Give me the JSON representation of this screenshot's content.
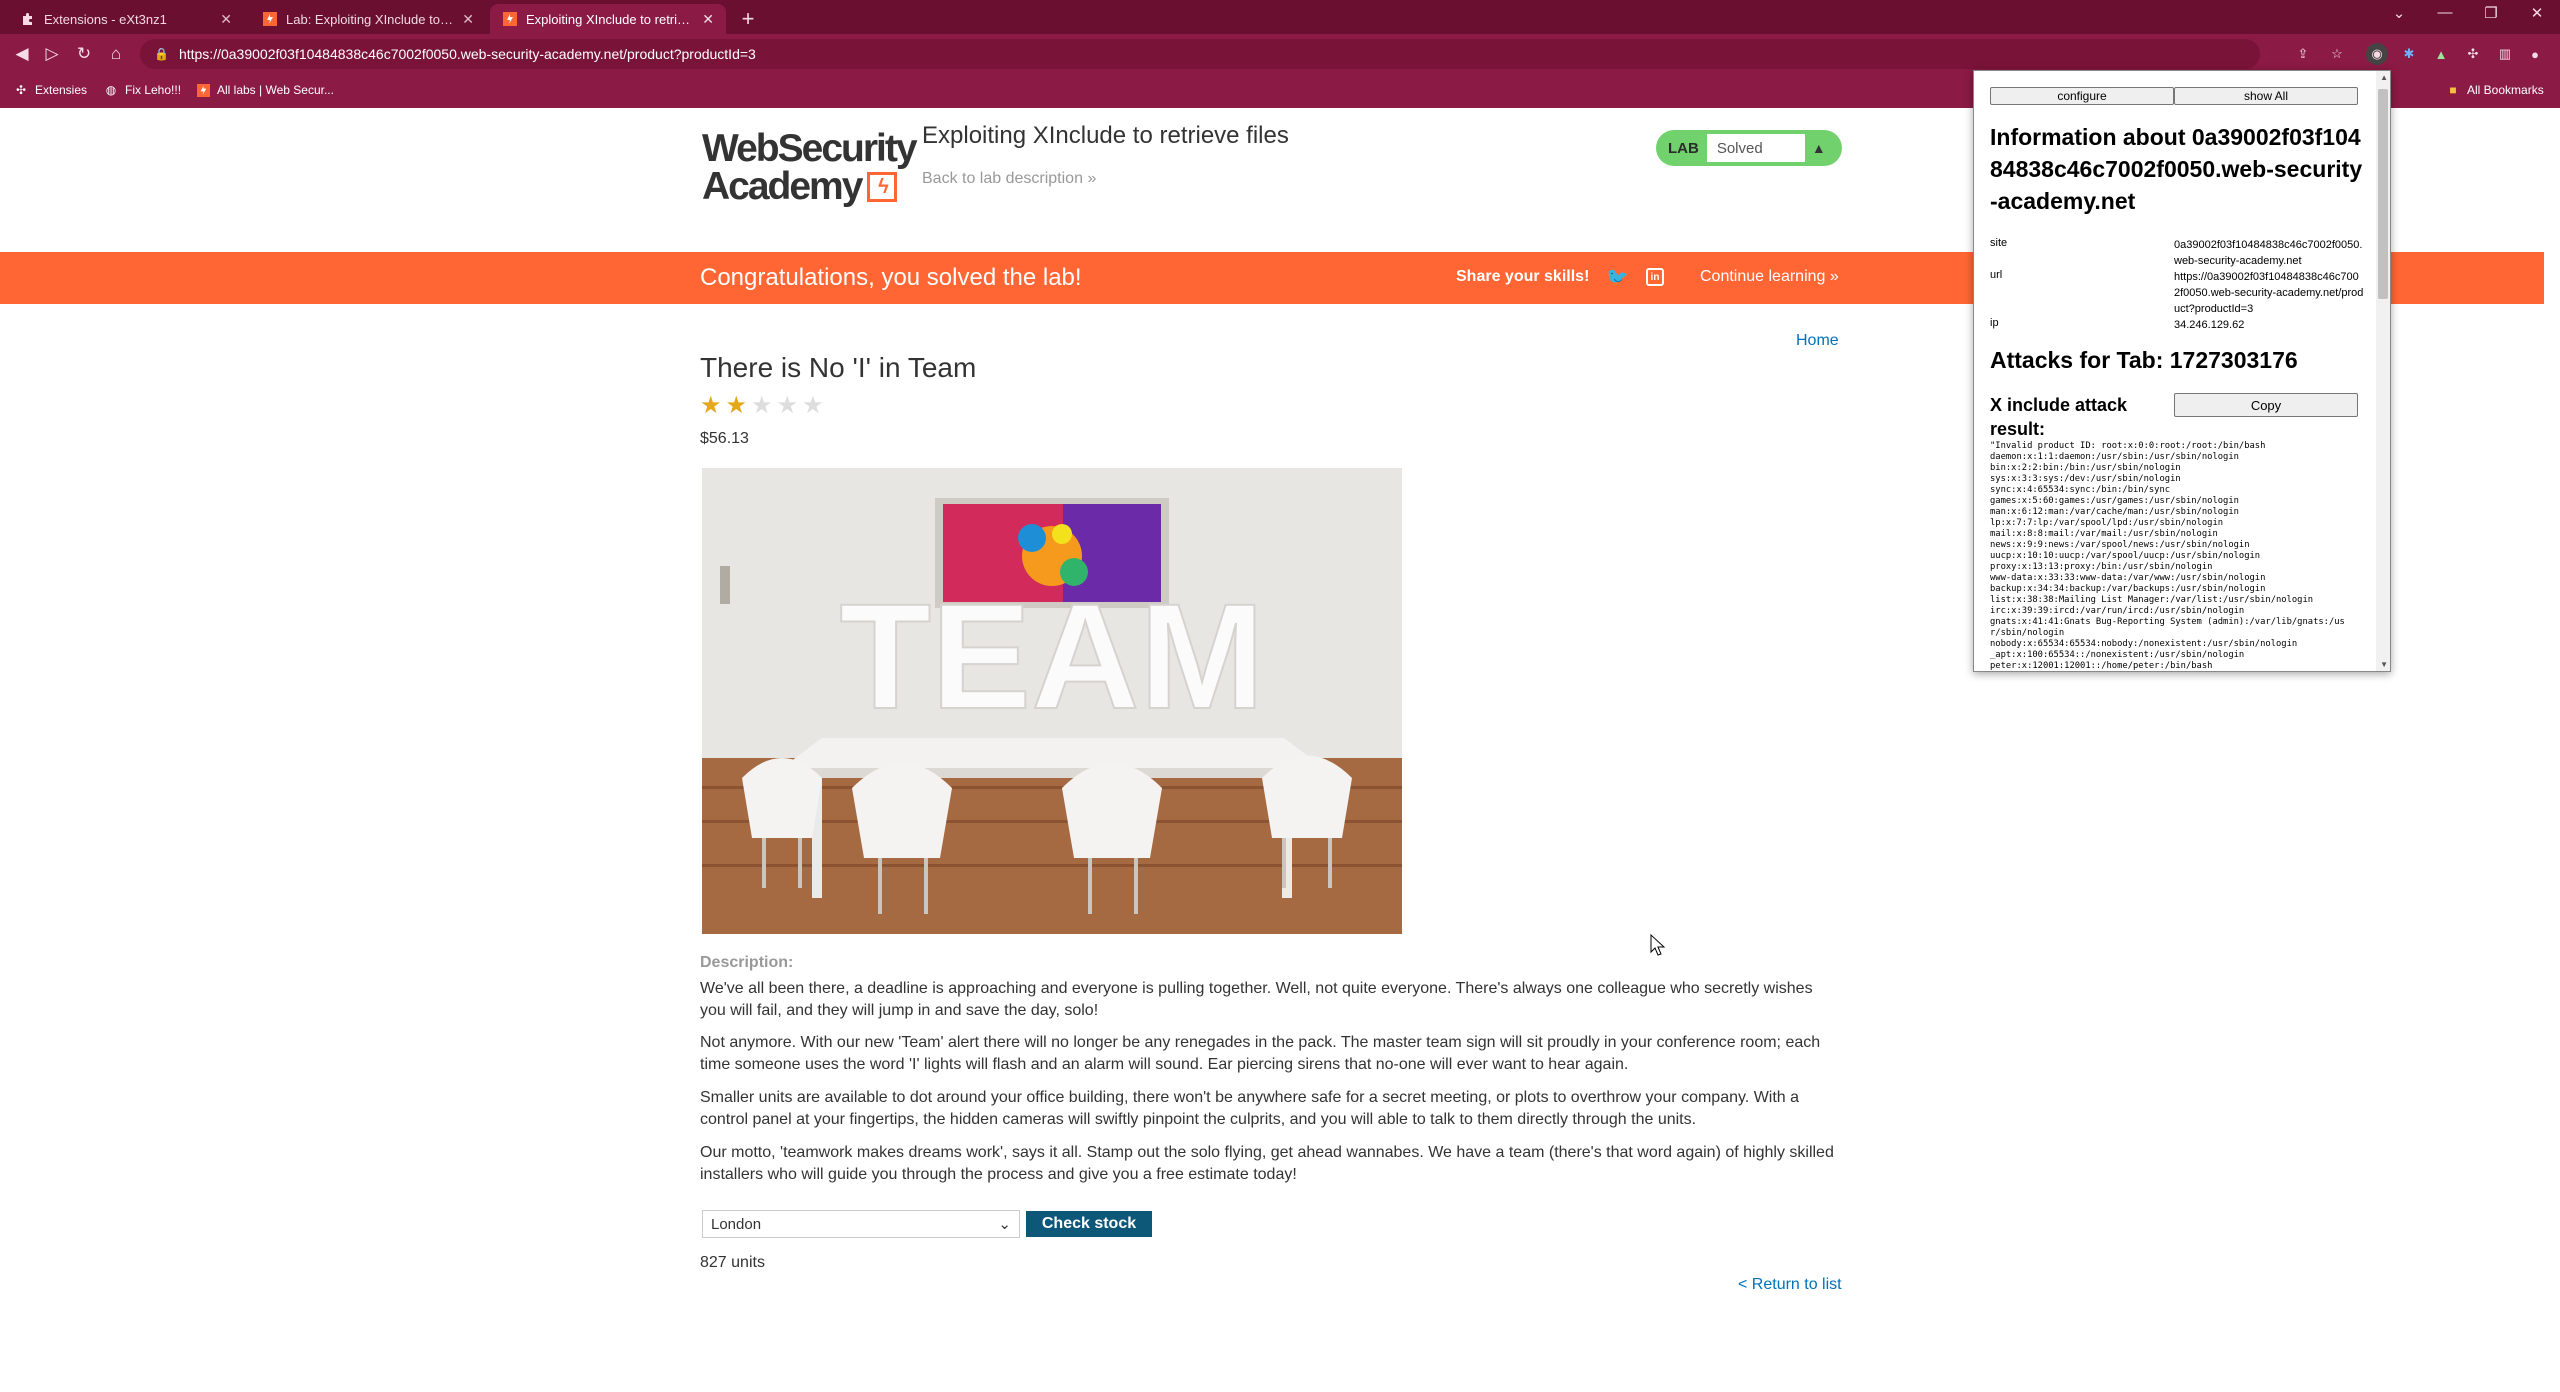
{
  "browser": {
    "tabs": [
      {
        "title": "Extensions - eXt3nz1",
        "active": false
      },
      {
        "title": "Lab: Exploiting XInclude to retri",
        "active": false
      },
      {
        "title": "Exploiting XInclude to retrieve f",
        "active": true
      }
    ],
    "new_tab": "+",
    "url": "https://0a39002f03f10484838c46c7002f0050.web-security-academy.net/product?productId=3",
    "bookmarks": [
      {
        "label": "Extensies",
        "icon": "puzzle-icon"
      },
      {
        "label": "Fix Leho!!!",
        "icon": "globe-icon"
      },
      {
        "label": "All labs | Web Secur...",
        "icon": "portswigger-icon"
      }
    ],
    "all_bookmarks": "All Bookmarks"
  },
  "header": {
    "logo_line1": "WebSecurity",
    "logo_line2": "Academy",
    "lab_title": "Exploiting XInclude to retrieve files",
    "back_link": "Back to lab description",
    "badge_lab": "LAB",
    "badge_status": "Solved"
  },
  "banner": {
    "message": "Congratulations, you solved the lab!",
    "share": "Share your skills!",
    "continue": "Continue learning"
  },
  "nav": {
    "home": "Home"
  },
  "product": {
    "name": "There is No 'I' in Team",
    "rating": 2,
    "rating_max": 5,
    "price": "$56.13",
    "image_text": "TEAM",
    "description_label": "Description:",
    "paragraphs": [
      "We've all been there, a deadline is approaching and everyone is pulling together. Well, not quite everyone. There's always one colleague who secretly wishes you will fail, and they will jump in and save the day, solo!",
      "Not anymore. With our new 'Team' alert there will no longer be any renegades in the pack. The master team sign will sit proudly in your conference room; each time someone uses the word 'I' lights will flash and an alarm will sound. Ear piercing sirens that no-one will ever want to hear again.",
      "Smaller units are available to dot around your office building, there won't be anywhere safe for a secret meeting, or plots to overthrow your company. With a control panel at your fingertips, the hidden cameras will swiftly pinpoint the culprits, and you will able to talk to them directly through the units.",
      "Our motto, 'teamwork makes dreams work', says it all. Stamp out the solo flying, get ahead wannabes. We have a team (there's that word again) of highly skilled installers who will guide you through the process and give you a free estimate today!"
    ],
    "stock_location": "London",
    "check_stock": "Check stock",
    "units": "827 units",
    "return": "< Return to list"
  },
  "popup": {
    "configure": "configure",
    "show_all": "show All",
    "info_title": "Information about 0a39002f03f10484838c46c7002f0050.web-security-academy.net",
    "site_label": "site",
    "site_value": "0a39002f03f10484838c46c7002f0050.web-security-academy.net",
    "url_label": "url",
    "url_value": "https://0a39002f03f10484838c46c7002f0050.web-security-academy.net/product?productId=3",
    "ip_label": "ip",
    "ip_value": "34.246.129.62",
    "attacks_title": "Attacks for Tab: 1727303176",
    "xinclude_title": "X include attack result:",
    "copy": "Copy",
    "result_lines": [
      "\"Invalid product ID: root:x:0:0:root:/root:/bin/bash",
      "daemon:x:1:1:daemon:/usr/sbin:/usr/sbin/nologin",
      "bin:x:2:2:bin:/bin:/usr/sbin/nologin",
      "sys:x:3:3:sys:/dev:/usr/sbin/nologin",
      "sync:x:4:65534:sync:/bin:/bin/sync",
      "games:x:5:60:games:/usr/games:/usr/sbin/nologin",
      "man:x:6:12:man:/var/cache/man:/usr/sbin/nologin",
      "lp:x:7:7:lp:/var/spool/lpd:/usr/sbin/nologin",
      "mail:x:8:8:mail:/var/mail:/usr/sbin/nologin",
      "news:x:9:9:news:/var/spool/news:/usr/sbin/nologin",
      "uucp:x:10:10:uucp:/var/spool/uucp:/usr/sbin/nologin",
      "proxy:x:13:13:proxy:/bin:/usr/sbin/nologin",
      "www-data:x:33:33:www-data:/var/www:/usr/sbin/nologin",
      "backup:x:34:34:backup:/var/backups:/usr/sbin/nologin",
      "list:x:38:38:Mailing List Manager:/var/list:/usr/sbin/nologin",
      "irc:x:39:39:ircd:/var/run/ircd:/usr/sbin/nologin",
      "gnats:x:41:41:Gnats Bug-Reporting System (admin):/var/lib/gnats:/us",
      "r/sbin/nologin",
      "nobody:x:65534:65534:nobody:/nonexistent:/usr/sbin/nologin",
      "_apt:x:100:65534::/nonexistent:/usr/sbin/nologin",
      "peter:x:12001:12001::/home/peter:/bin/bash"
    ]
  },
  "colors": {
    "tabstrip": "#6a0f30",
    "toolbar": "#8b1a44",
    "accent": "#ff6633",
    "solved": "#70d16d",
    "link": "#0071bc",
    "button": "#0d5778"
  }
}
